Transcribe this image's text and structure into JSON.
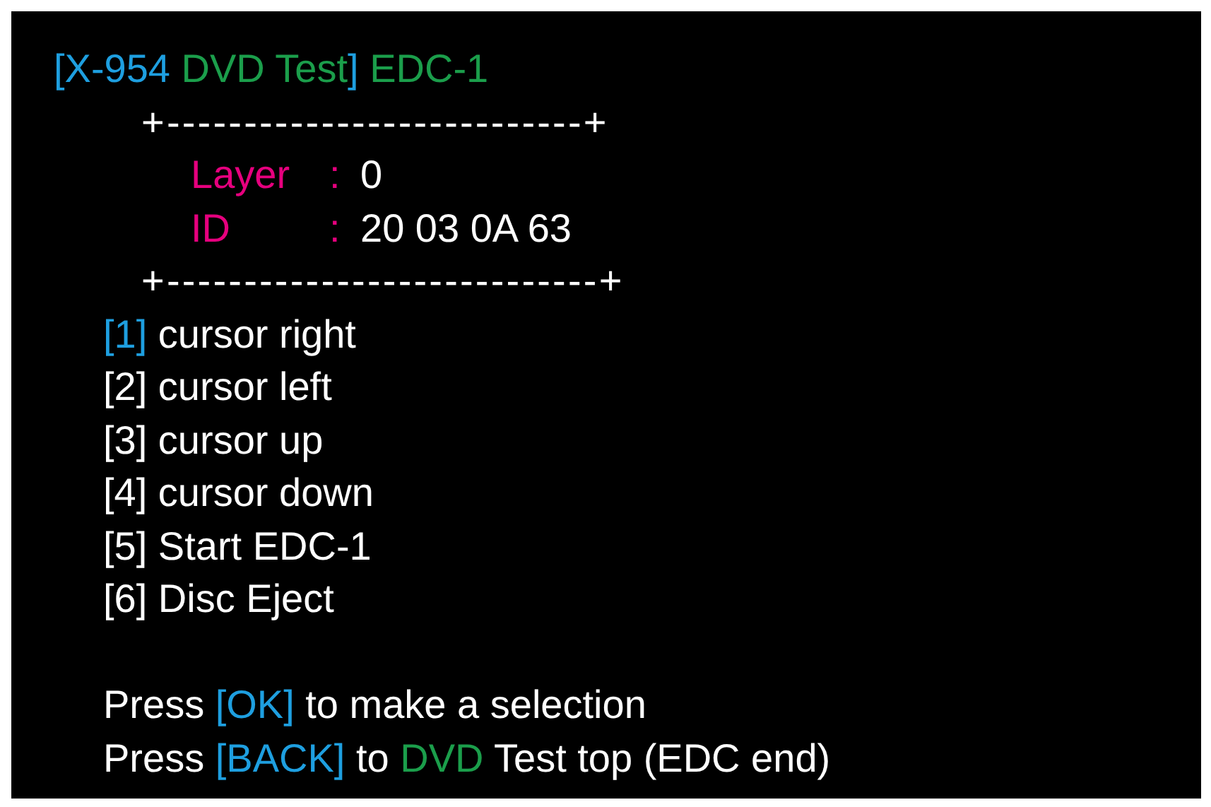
{
  "title": [
    {
      "text": "[X-954 ",
      "color": "#1e9fe0"
    },
    {
      "text": "DVD Test",
      "color": "#1b9e4b"
    },
    {
      "text": "]",
      "color": "#1e9fe0"
    },
    {
      "text": " EDC-1",
      "color": "#1b9e4b"
    }
  ],
  "info_box": {
    "border_top": "+---------------------------+",
    "fields": [
      {
        "label": "Layer",
        "separator": ":",
        "value": "0"
      },
      {
        "label": "ID",
        "separator": ":",
        "value": "20 03 0A 63"
      }
    ],
    "border_bottom": "+----------------------------+"
  },
  "menu_items": [
    {
      "key": "[1]",
      "label": "cursor right",
      "selected": true
    },
    {
      "key": "[2]",
      "label": "cursor left",
      "selected": false
    },
    {
      "key": "[3]",
      "label": "cursor up",
      "selected": false
    },
    {
      "key": "[4]",
      "label": "cursor down",
      "selected": false
    },
    {
      "key": "[5]",
      "label": "Start EDC-1",
      "selected": false
    },
    {
      "key": "[6]",
      "label": "Disc Eject",
      "selected": false
    }
  ],
  "instructions": [
    [
      {
        "text": "Press ",
        "color": "#ffffff"
      },
      {
        "text": "[OK]",
        "color": "#1e9fe0"
      },
      {
        "text": " to make a selection",
        "color": "#ffffff"
      }
    ],
    [
      {
        "text": "Press ",
        "color": "#ffffff"
      },
      {
        "text": "[BACK]",
        "color": "#1e9fe0"
      },
      {
        "text": " to ",
        "color": "#ffffff"
      },
      {
        "text": "DVD",
        "color": "#1b9e4b"
      },
      {
        "text": " Test top (EDC end)",
        "color": "#ffffff"
      }
    ]
  ]
}
